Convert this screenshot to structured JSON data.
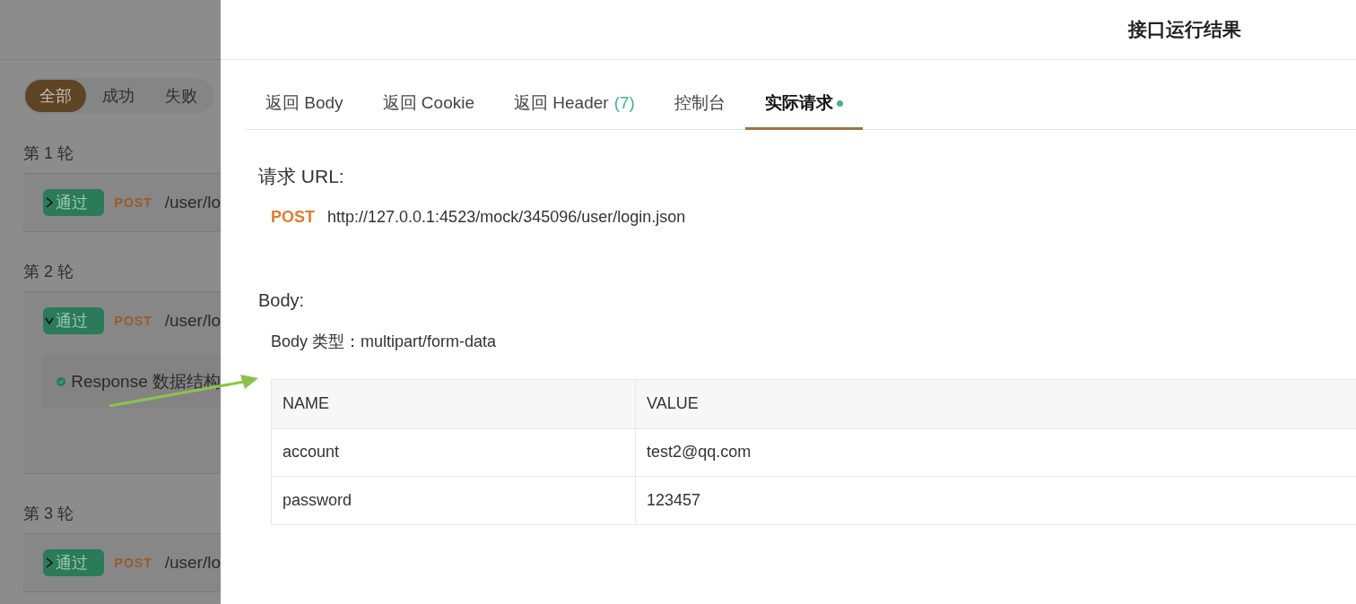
{
  "left_panel": {
    "filters": [
      {
        "label": "全部",
        "selected": true
      },
      {
        "label": "成功",
        "selected": false
      },
      {
        "label": "失败",
        "selected": false
      }
    ],
    "rounds": [
      {
        "label": "第 1 轮",
        "expanded": false,
        "status": "通过",
        "method": "POST",
        "path": "/user/lo"
      },
      {
        "label": "第 2 轮",
        "expanded": true,
        "status": "通过",
        "method": "POST",
        "path": "/user/lo",
        "assertions": [
          {
            "text": "Response 数据结构"
          }
        ]
      },
      {
        "label": "第 3 轮",
        "expanded": false,
        "status": "通过",
        "method": "POST",
        "path": "/user/lo"
      }
    ]
  },
  "drawer": {
    "title": "接口运行结果",
    "tabs": [
      {
        "label": "返回 Body",
        "selected": false
      },
      {
        "label": "返回 Cookie",
        "selected": false
      },
      {
        "label": "返回 Header",
        "count": "(7)",
        "selected": false
      },
      {
        "label": "控制台",
        "selected": false
      },
      {
        "label": "实际请求",
        "selected": true,
        "dot": true
      }
    ],
    "request_url": {
      "heading": "请求 URL:",
      "method": "POST",
      "url": "http://127.0.0.1:4523/mock/345096/user/login.json"
    },
    "body": {
      "heading": "Body:",
      "type_label": "Body 类型：multipart/form-data",
      "table": {
        "columns": [
          "NAME",
          "VALUE"
        ],
        "rows": [
          [
            "account",
            "test2@qq.com"
          ],
          [
            "password",
            "123457"
          ]
        ]
      }
    }
  }
}
